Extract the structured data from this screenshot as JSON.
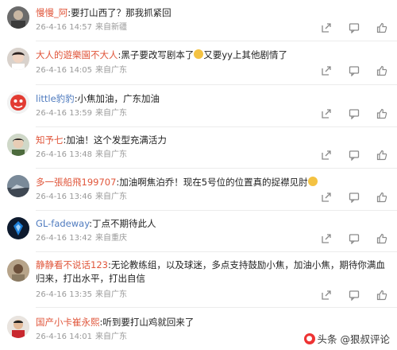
{
  "comments": [
    {
      "user": "慢慢_阿",
      "text": ":要打山西了？那我抓紧回",
      "date": "26-4-16 14:57",
      "location": "来自新疆",
      "name_color": "red"
    },
    {
      "user": "大人的遊樂園不大人",
      "text": ":黑子要改写剧本了",
      "text2": "又要yy上其他剧情了",
      "date": "26-4-16 14:05",
      "location": "来自广东",
      "name_color": "red"
    },
    {
      "user": "little豹豹",
      "text": ":小焦加油，广东加油",
      "date": "26-4-16 13:59",
      "location": "来自广东",
      "name_color": "blue"
    },
    {
      "user": "知予七",
      "text": ":加油！这个发型充满活力",
      "date": "26-4-16 13:48",
      "location": "来自广东",
      "name_color": "red"
    },
    {
      "user": "多一張船飛199707",
      "text": ":加油啊焦泊乔！现在5号位的位置真的捉襟见肘",
      "date": "26-4-16 13:46",
      "location": "来自广东",
      "name_color": "red"
    },
    {
      "user": "GL-fadeway",
      "text": ":丁点不期待此人",
      "date": "26-4-16 13:42",
      "location": "来自重庆",
      "name_color": "blue"
    },
    {
      "user": "静静看不说话123",
      "text": ":无论教练组，以及球迷，多点支持鼓励小焦，加油小焦，期待你满血归来，打出水平，打出自信",
      "date": "26-4-16 13:35",
      "location": "来自广东",
      "name_color": "red"
    },
    {
      "user": "国产小卡崔永熙",
      "text": ":听到要打山鸡就回来了",
      "date": "26-4-16 14:01",
      "location": "来自广东",
      "name_color": "red"
    }
  ],
  "actions": {
    "share_icon": "share-icon",
    "comment_icon": "comment-icon",
    "like_icon": "like-icon"
  },
  "watermark": {
    "text": "头条 @狠叔评论"
  }
}
